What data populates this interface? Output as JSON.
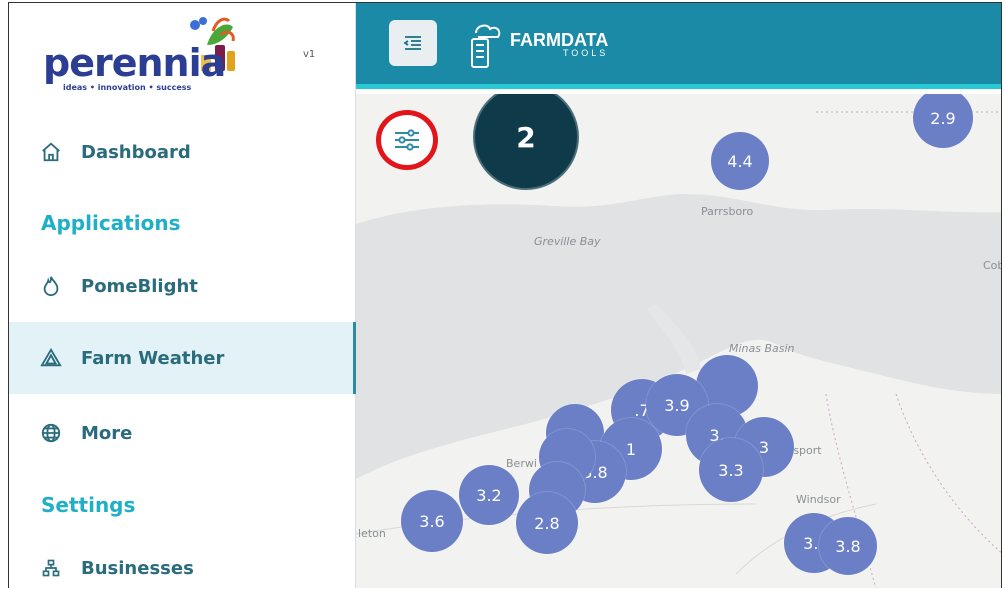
{
  "brand": {
    "name": "perennia",
    "tagline": "ideas • innovation • success",
    "version": "v1"
  },
  "sidebar": {
    "items": [
      {
        "label": "Dashboard",
        "icon": "home-icon"
      },
      {
        "label": "PomeBlight",
        "icon": "flame-icon"
      },
      {
        "label": "Farm Weather",
        "icon": "triangle-icon",
        "active": true
      },
      {
        "label": "More",
        "icon": "globe-icon"
      },
      {
        "label": "Businesses",
        "icon": "org-chart-icon"
      }
    ],
    "sections": {
      "applications": "Applications",
      "settings": "Settings"
    }
  },
  "topbar": {
    "app_name": "FARMDATA",
    "app_sub": "TOOLS",
    "menu_icon": "indent-icon"
  },
  "map": {
    "places": {
      "parrsboro": "Parrsboro",
      "greville": "Greville Bay",
      "minas": "Minas Basin",
      "berwick": "Berwi",
      "hantsport": "tsport",
      "windsor": "Windsor",
      "cob": "Cob",
      "kentville": "leton"
    },
    "clusters": [
      {
        "label": "2.9"
      },
      {
        "label": "4.4"
      },
      {
        "label": ""
      },
      {
        "label": ".7"
      },
      {
        "label": "3.9"
      },
      {
        "label": ""
      },
      {
        "label": "3."
      },
      {
        "label": "3"
      },
      {
        "label": "3.3"
      },
      {
        "label": "1"
      },
      {
        "label": "3.8"
      },
      {
        "label": ""
      },
      {
        "label": ""
      },
      {
        "label": "3.2"
      },
      {
        "label": "2.8"
      },
      {
        "label": "3.6"
      },
      {
        "label": "3.!"
      },
      {
        "label": "3.8"
      }
    ],
    "step_badge": "2"
  },
  "colors": {
    "topbar": "#1a8aa6",
    "accent_line": "#27c9d6",
    "cluster": "#6b7fc7",
    "highlight": "#e2151b",
    "badge": "#0f3a49"
  }
}
